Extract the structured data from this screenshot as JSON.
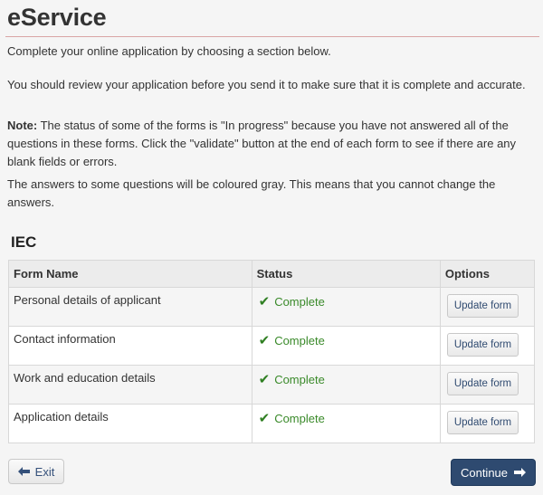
{
  "page": {
    "title": "eService",
    "intro": "Complete your online application by choosing a section below.",
    "review": "You should review your application before you send it to make sure that it is complete and accurate.",
    "note_label": "Note:",
    "note_text": " The status of some of the forms is \"In progress\" because you have not answered all of the questions in these forms. Click the \"validate\" button at the end of each form to see if there are any blank fields or errors.",
    "gray_text": "The answers to some questions will be coloured gray. This means that you cannot change the answers."
  },
  "section": {
    "title": "IEC",
    "headers": {
      "name": "Form Name",
      "status": "Status",
      "options": "Options"
    },
    "rows": [
      {
        "name": "Personal details of applicant",
        "status": "Complete",
        "action": "Update form"
      },
      {
        "name": "Contact information",
        "status": "Complete",
        "action": "Update form"
      },
      {
        "name": "Work and education details",
        "status": "Complete",
        "action": "Update form"
      },
      {
        "name": "Application details",
        "status": "Complete",
        "action": "Update form"
      }
    ]
  },
  "footer": {
    "exit_label": "Exit",
    "continue_label": "Continue"
  },
  "icons": {
    "status": "check-icon",
    "exit": "arrow-left-icon",
    "continue": "arrow-right-icon"
  },
  "colors": {
    "complete": "#3a8a2a",
    "primary_button": "#2e4a70",
    "title_rule": "#d9a5a5"
  }
}
